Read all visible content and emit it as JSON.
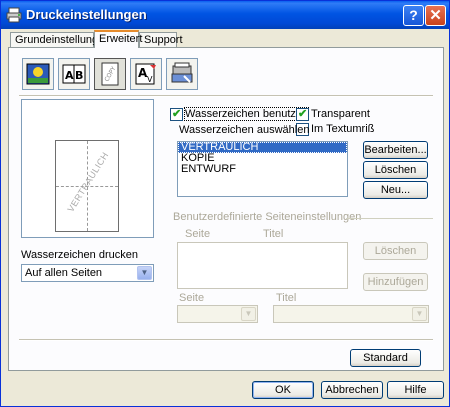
{
  "window": {
    "title": "Druckeinstellungen",
    "help_glyph": "?",
    "close_glyph": "✕"
  },
  "tabs": [
    {
      "label": "Grundeinstellungen",
      "active": false
    },
    {
      "label": "Erweitert",
      "active": true
    },
    {
      "label": "Support",
      "active": false
    }
  ],
  "toolbar": {
    "icons": [
      "print-quality-icon",
      "duplex-icon",
      "watermark-icon",
      "page-setting-icon",
      "device-options-icon"
    ],
    "pressed_index": 2
  },
  "preview": {
    "watermark_text": "VERTRAULICH"
  },
  "watermark_print": {
    "label": "Wasserzeichen drucken",
    "selected": "Auf allen Seiten"
  },
  "watermark": {
    "use_label": "Wasserzeichen benutzen",
    "use_checked": true,
    "transparent_label": "Transparent",
    "transparent_checked": true,
    "outline_label": "Im Textumriß",
    "outline_checked": false,
    "select_label": "Wasserzeichen auswählen",
    "items": [
      "VERTRAULICH",
      "KOPIE",
      "ENTWURF"
    ],
    "selected_index": 0,
    "edit_button": "Bearbeiten...",
    "delete_button": "Löschen",
    "new_button": "Neu..."
  },
  "custom_pages": {
    "group_label": "Benutzerdefinierte Seiteneinstellungen",
    "col_page": "Seite",
    "col_title": "Titel",
    "delete_button": "Löschen",
    "add_button": "Hinzufügen",
    "page_label": "Seite",
    "title_label": "Titel"
  },
  "footer": {
    "standard_button": "Standard",
    "ok_button": "OK",
    "cancel_button": "Abbrechen",
    "help_button": "Hilfe"
  }
}
